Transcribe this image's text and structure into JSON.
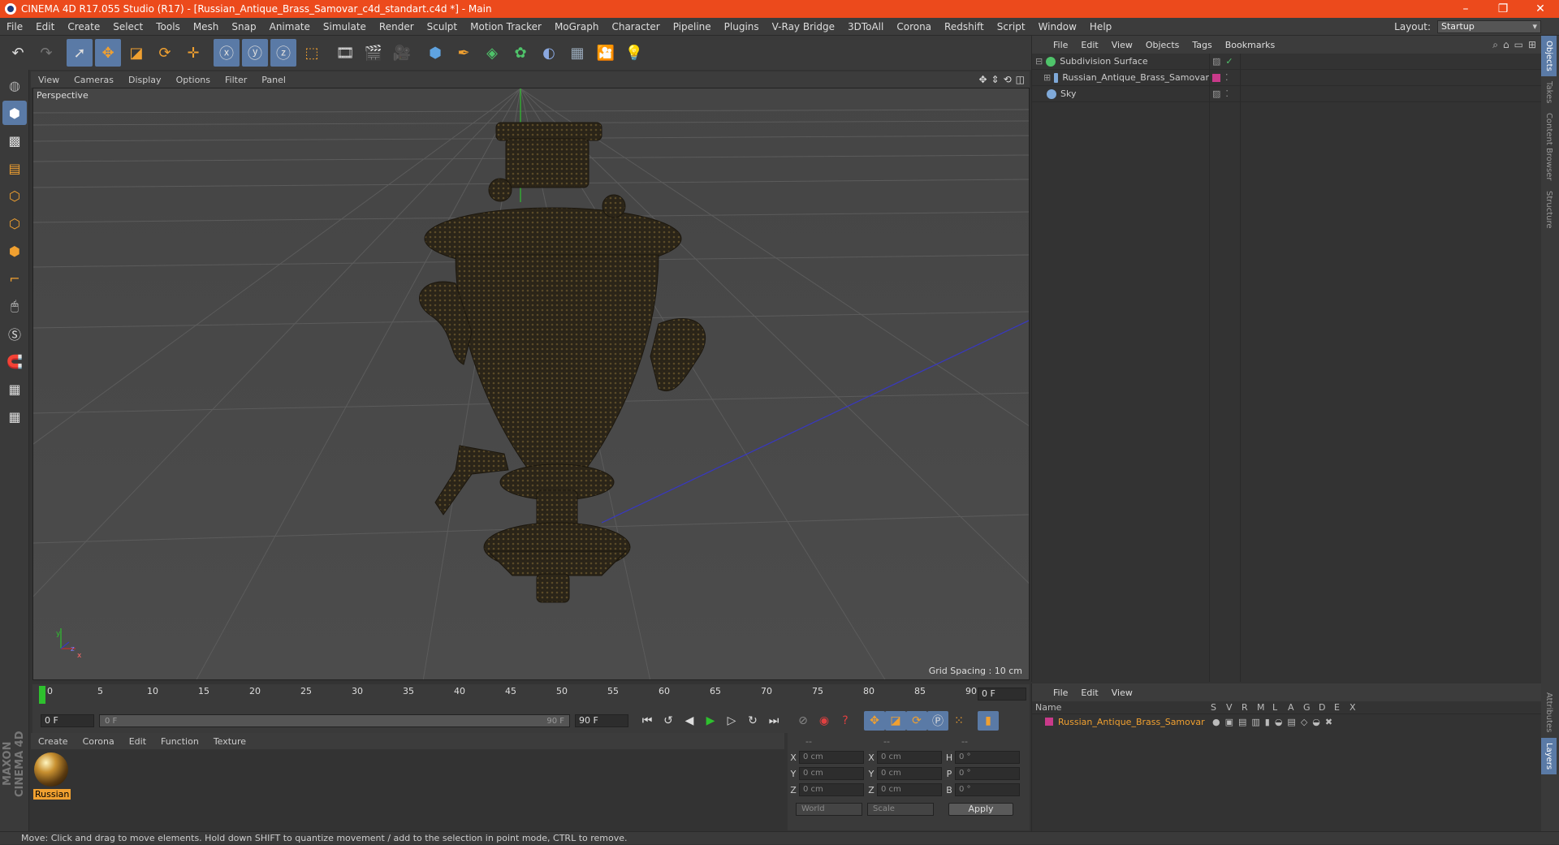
{
  "titlebar": {
    "title": "CINEMA 4D R17.055 Studio (R17) - [Russian_Antique_Brass_Samovar_c4d_standart.c4d *] - Main",
    "minimize": "–",
    "maximize": "❐",
    "close": "✕"
  },
  "menu": {
    "items": [
      "File",
      "Edit",
      "Create",
      "Select",
      "Tools",
      "Mesh",
      "Snap",
      "Animate",
      "Simulate",
      "Render",
      "Sculpt",
      "Motion Tracker",
      "MoGraph",
      "Character",
      "Pipeline",
      "Plugins",
      "V-Ray Bridge",
      "3DToAll",
      "Corona",
      "Redshift",
      "Script",
      "Window",
      "Help"
    ],
    "layout_label": "Layout:",
    "layout_value": "Startup"
  },
  "viewport": {
    "menu": [
      "View",
      "Cameras",
      "Display",
      "Options",
      "Filter",
      "Panel"
    ],
    "label": "Perspective",
    "grid_spacing": "Grid Spacing : 10 cm",
    "axis": {
      "y": "y",
      "z": "z",
      "x": "x"
    }
  },
  "timeline": {
    "ticks": [
      "0",
      "5",
      "10",
      "15",
      "20",
      "25",
      "30",
      "35",
      "40",
      "45",
      "50",
      "55",
      "60",
      "65",
      "70",
      "75",
      "80",
      "85",
      "90"
    ],
    "current_frame": "0 F",
    "start_field": "0 F",
    "range_start": "0 F",
    "range_end": "90 F",
    "end_field": "90 F"
  },
  "material": {
    "menu": [
      "Create",
      "Corona",
      "Edit",
      "Function",
      "Texture"
    ],
    "name": "Russian"
  },
  "coords": {
    "header": [
      "--",
      "--",
      "--"
    ],
    "rows": [
      {
        "a": "X",
        "av": "0 cm",
        "b": "X",
        "bv": "0 cm",
        "c": "H",
        "cv": "0 °"
      },
      {
        "a": "Y",
        "av": "0 cm",
        "b": "Y",
        "bv": "0 cm",
        "c": "P",
        "cv": "0 °"
      },
      {
        "a": "Z",
        "av": "0 cm",
        "b": "Z",
        "bv": "0 cm",
        "c": "B",
        "cv": "0 °"
      }
    ],
    "world": "World",
    "scale": "Scale",
    "apply": "Apply"
  },
  "objects": {
    "menu": [
      "File",
      "Edit",
      "View",
      "Objects",
      "Tags",
      "Bookmarks"
    ],
    "items": [
      {
        "name": "Subdivision Surface",
        "color": "#4fc36a"
      },
      {
        "name": "Russian_Antique_Brass_Samovar",
        "color": "#c93a8a"
      },
      {
        "name": "Sky",
        "color": "#7fa9d9"
      }
    ]
  },
  "side_tabs": [
    "Objects",
    "Takes",
    "Content Browser",
    "Structure",
    "Attributes",
    "Layers"
  ],
  "layers": {
    "menu": [
      "File",
      "Edit",
      "View"
    ],
    "columns": [
      "Name",
      "S",
      "V",
      "R",
      "M",
      "L",
      "A",
      "G",
      "D",
      "E",
      "X"
    ],
    "row": "Russian_Antique_Brass_Samovar"
  },
  "status": "Move: Click and drag to move elements. Hold down SHIFT to quantize movement / add to the selection in point mode, CTRL to remove.",
  "colors": {
    "accent": "#ec4a1c",
    "highlight": "#5a7aa6",
    "orange": "#f0a030"
  }
}
